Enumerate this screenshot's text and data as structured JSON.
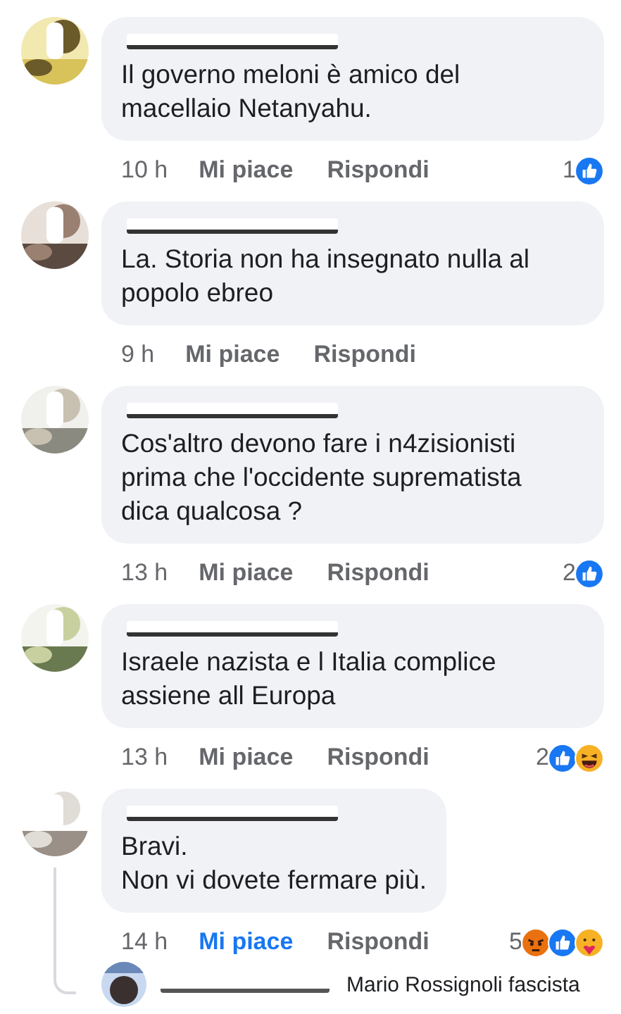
{
  "comments": [
    {
      "text": "Il governo meloni è amico del macellaio Netanyahu.",
      "time": "10 h",
      "like_label": "Mi piace",
      "liked": false,
      "reply_label": "Rispondi",
      "reaction_count": "1",
      "reactions": [
        {
          "kind": "like"
        }
      ]
    },
    {
      "text": "La. Storia non ha insegnato nulla al popolo ebreo",
      "time": "9 h",
      "like_label": "Mi piace",
      "liked": false,
      "reply_label": "Rispondi"
    },
    {
      "text": "Cos'altro devono fare i n4zisionisti prima che l'occidente suprematista dica qualcosa ?",
      "time": "13 h",
      "like_label": "Mi piace",
      "liked": false,
      "reply_label": "Rispondi",
      "reaction_count": "2",
      "reactions": [
        {
          "kind": "like"
        }
      ]
    },
    {
      "text": "Israele nazista e l Italia complice assiene all Europa",
      "time": "13 h",
      "like_label": "Mi piace",
      "liked": false,
      "reply_label": "Rispondi",
      "reaction_count": "2",
      "reactions": [
        {
          "kind": "like"
        },
        {
          "kind": "haha"
        }
      ]
    },
    {
      "text": "Bravi.\nNon vi dovete fermare più.",
      "time": "14 h",
      "like_label": "Mi piace",
      "liked": true,
      "reply_label": "Rispondi",
      "reaction_count": "5",
      "reactions": [
        {
          "kind": "angry"
        },
        {
          "kind": "like"
        },
        {
          "kind": "care"
        }
      ],
      "replies": [
        {
          "text": "Mario Rossignoli fascista"
        }
      ]
    }
  ]
}
